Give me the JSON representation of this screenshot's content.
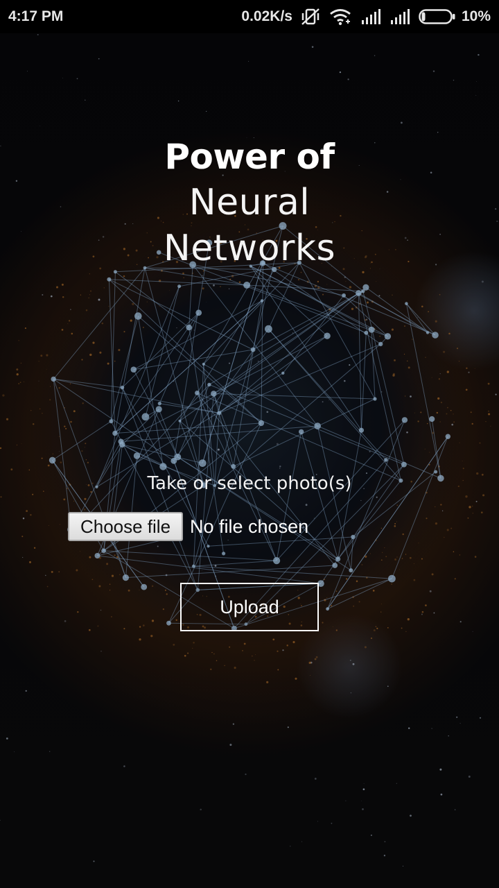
{
  "status_bar": {
    "time": "4:17 PM",
    "net_speed": "0.02K/s",
    "battery_percent": "10%",
    "icons": [
      "vibrate-off-icon",
      "wifi-icon",
      "signal-icon",
      "signal-icon",
      "battery-icon"
    ]
  },
  "hero": {
    "title_bold": "Power of",
    "title_light_line1": "Neural",
    "title_light_line2": "Networks"
  },
  "upload_form": {
    "prompt": "Take or select photo(s)",
    "choose_file_label": "Choose file",
    "file_status": "No file chosen",
    "upload_label": "Upload"
  },
  "colors": {
    "background": "#070709",
    "text": "#ffffff",
    "network_lines": "#9fc3e6",
    "nebula": "#8a4a14"
  }
}
